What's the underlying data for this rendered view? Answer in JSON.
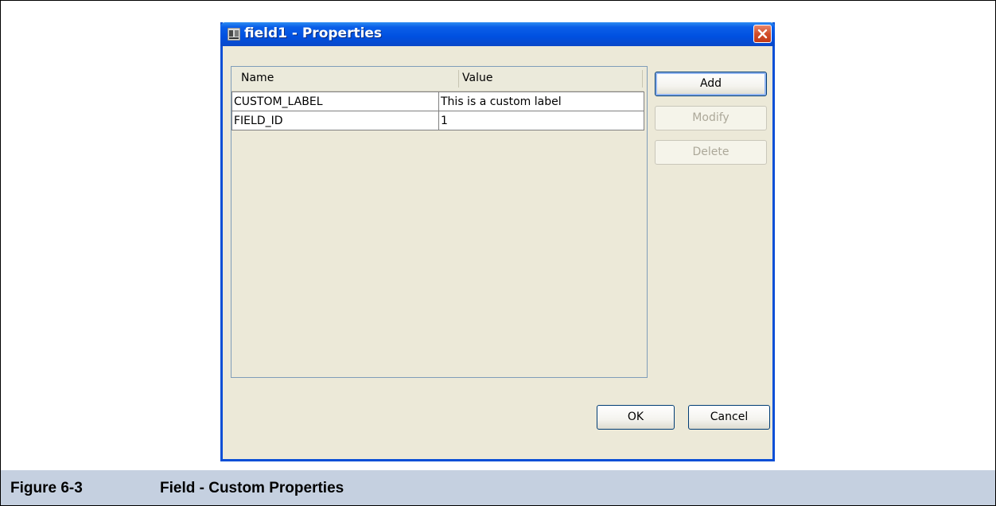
{
  "dialog": {
    "title": "field1 - Properties",
    "table": {
      "columns": [
        "Name",
        "Value"
      ],
      "rows": [
        {
          "name": "CUSTOM_LABEL",
          "value": "This is a custom label"
        },
        {
          "name": "FIELD_ID",
          "value": "1"
        }
      ]
    },
    "buttons": {
      "add": "Add",
      "modify": "Modify",
      "delete": "Delete",
      "ok": "OK",
      "cancel": "Cancel"
    }
  },
  "caption": {
    "number": "Figure 6-3",
    "text": "Field - Custom Properties"
  },
  "colors": {
    "titlebar": "#0050e0",
    "dialog_bg": "#ece9d8",
    "caption_bg": "#c5d0e0",
    "close_button": "#d24e2a"
  }
}
